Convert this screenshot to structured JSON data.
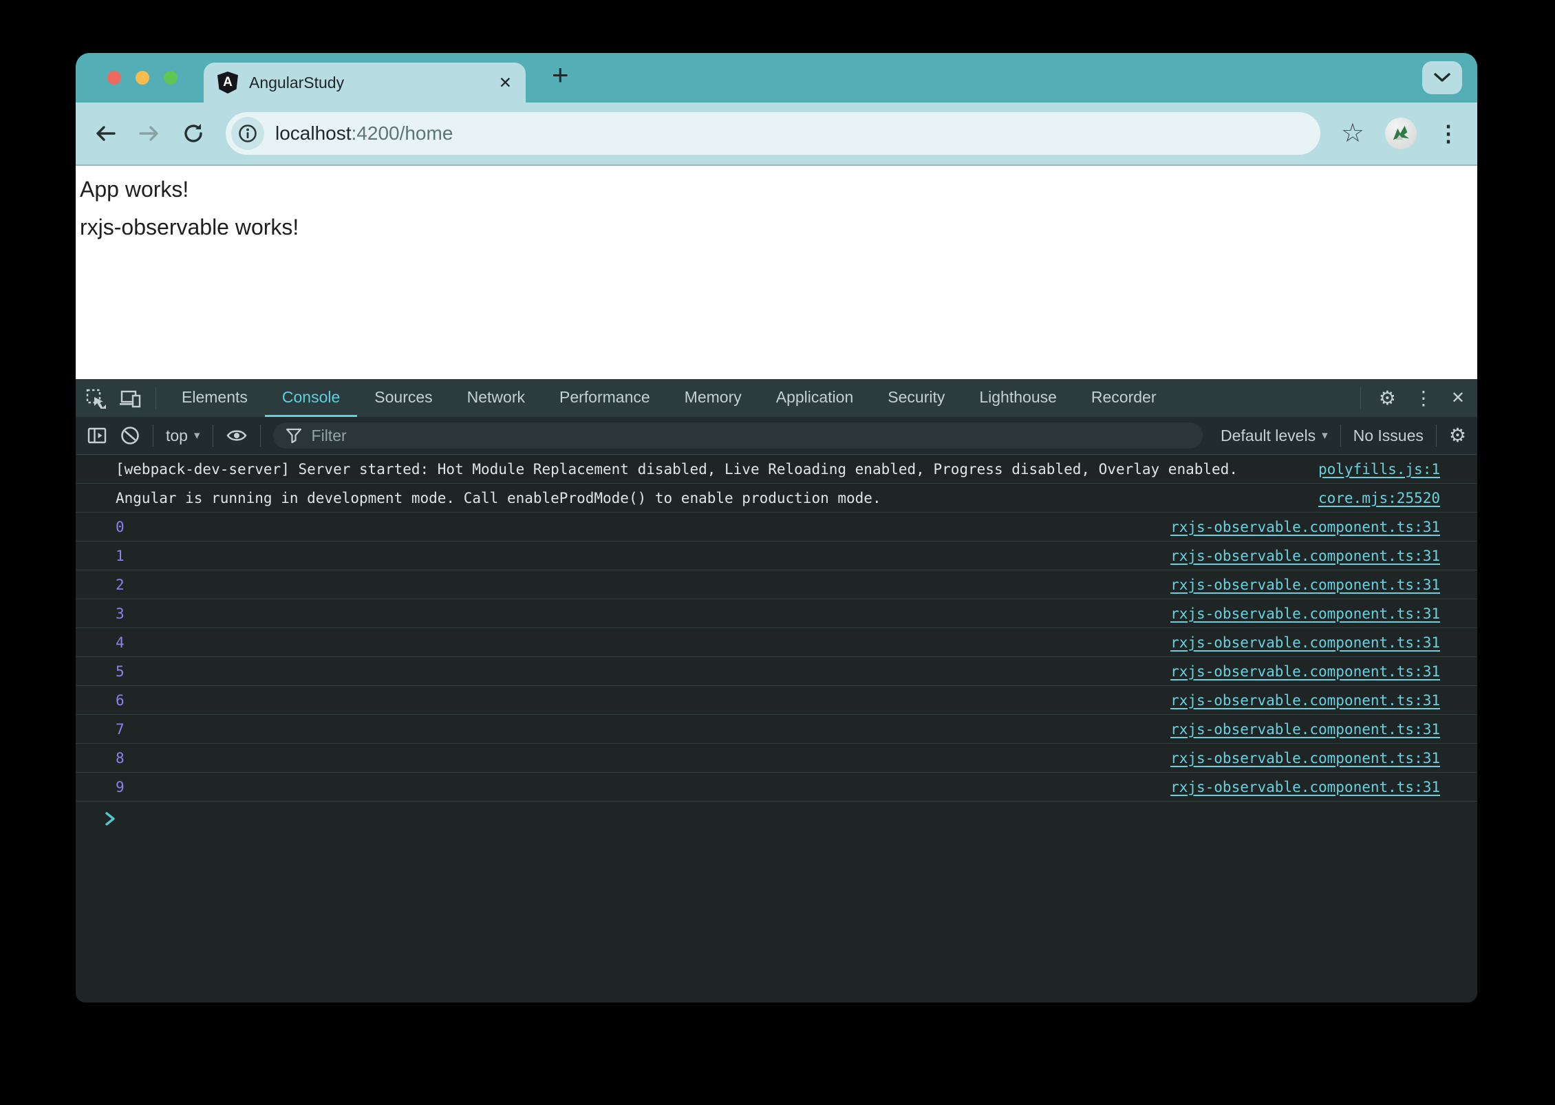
{
  "colors": {
    "titlebar": "#53AEB6",
    "tab_active_bg": "#B7DDE2",
    "url_pill_bg": "#E7F3F4",
    "traffic_red": "#EE6A5F",
    "traffic_yellow": "#F5BD4F",
    "traffic_green": "#61C554",
    "devtools_accent": "#5BD2DF",
    "devtools_link": "#6BD0DE",
    "console_number": "#8E80E8",
    "prompt": "#54C6CC"
  },
  "icons": {
    "close": "✕",
    "plus": "+",
    "gear": "⚙",
    "dots_vertical": "⋮",
    "star": "☆",
    "caret": "▾"
  },
  "browser": {
    "tab": {
      "title": "AngularStudy",
      "favicon_letter": "A"
    },
    "url": {
      "host": "localhost",
      "path": ":4200/home"
    }
  },
  "page": {
    "lines": [
      "App works!",
      "rxjs-observable works!"
    ]
  },
  "devtools": {
    "tabs": [
      {
        "label": "Elements"
      },
      {
        "label": "Console",
        "active": true
      },
      {
        "label": "Sources"
      },
      {
        "label": "Network"
      },
      {
        "label": "Performance"
      },
      {
        "label": "Memory"
      },
      {
        "label": "Application"
      },
      {
        "label": "Security"
      },
      {
        "label": "Lighthouse"
      },
      {
        "label": "Recorder"
      }
    ],
    "console": {
      "context_label": "top",
      "filter_placeholder": "Filter",
      "levels_label": "Default levels",
      "issues_label": "No Issues",
      "messages": [
        {
          "kind": "text",
          "text": "[webpack-dev-server] Server started: Hot Module Replacement disabled, Live Reloading enabled, Progress disabled, Overlay enabled.",
          "source": "polyfills.js:1"
        },
        {
          "kind": "text",
          "text": "Angular is running in development mode. Call enableProdMode() to enable production mode.",
          "source": "core.mjs:25520"
        },
        {
          "kind": "number",
          "text": "0",
          "source": "rxjs-observable.component.ts:31"
        },
        {
          "kind": "number",
          "text": "1",
          "source": "rxjs-observable.component.ts:31"
        },
        {
          "kind": "number",
          "text": "2",
          "source": "rxjs-observable.component.ts:31"
        },
        {
          "kind": "number",
          "text": "3",
          "source": "rxjs-observable.component.ts:31"
        },
        {
          "kind": "number",
          "text": "4",
          "source": "rxjs-observable.component.ts:31"
        },
        {
          "kind": "number",
          "text": "5",
          "source": "rxjs-observable.component.ts:31"
        },
        {
          "kind": "number",
          "text": "6",
          "source": "rxjs-observable.component.ts:31"
        },
        {
          "kind": "number",
          "text": "7",
          "source": "rxjs-observable.component.ts:31"
        },
        {
          "kind": "number",
          "text": "8",
          "source": "rxjs-observable.component.ts:31"
        },
        {
          "kind": "number",
          "text": "9",
          "source": "rxjs-observable.component.ts:31"
        }
      ]
    }
  }
}
